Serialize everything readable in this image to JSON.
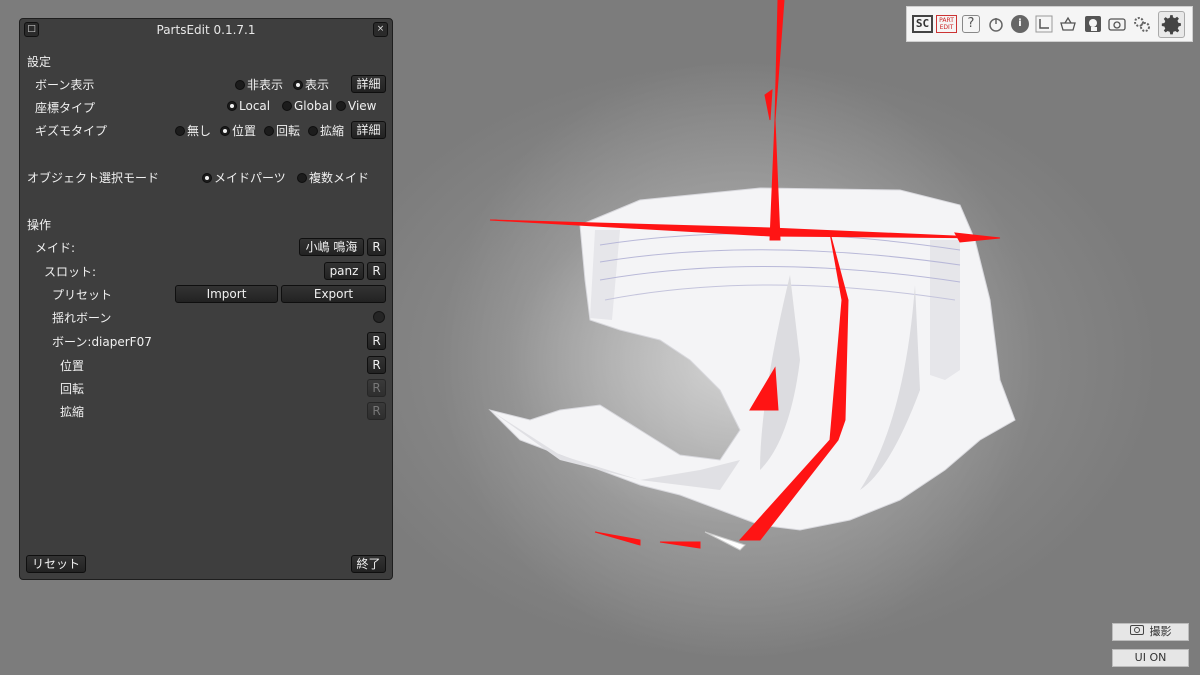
{
  "panel": {
    "title": "PartsEdit 0.1.7.1",
    "close_glyph": "×",
    "min_glyph": "□",
    "settings": {
      "heading": "設定",
      "bone_display": {
        "label": "ボーン表示",
        "options": [
          "非表示",
          "表示"
        ],
        "selected": "表示",
        "detail_button": "詳細"
      },
      "coord_type": {
        "label": "座標タイプ",
        "options": [
          "Local",
          "Global",
          "View"
        ],
        "selected": "Local"
      },
      "gizmo_type": {
        "label": "ギズモタイプ",
        "options": [
          "無し",
          "位置",
          "回転",
          "拡縮"
        ],
        "selected": "位置",
        "detail_button": "詳細"
      },
      "object_select": {
        "label": "オブジェクト選択モード",
        "options": [
          "メイドパーツ",
          "複数メイド"
        ],
        "selected": "メイドパーツ"
      }
    },
    "operations": {
      "heading": "操作",
      "maid": {
        "label": "メイド:",
        "value": "小嶋 鳴海",
        "reset": "R"
      },
      "slot": {
        "label": "スロット:",
        "value": "panz",
        "reset": "R"
      },
      "preset": {
        "label": "プリセット",
        "import": "Import",
        "export": "Export"
      },
      "sway_bone": {
        "label": "揺れボーン"
      },
      "bone": {
        "label": "ボーン:diaperF07",
        "reset": "R"
      },
      "position": {
        "label": "位置",
        "reset": "R"
      },
      "rotation": {
        "label": "回転",
        "reset": "R"
      },
      "scale": {
        "label": "拡縮",
        "reset": "R"
      }
    },
    "reset_button": "リセット",
    "exit_button": "終了"
  },
  "toolbar": {
    "sc": "SC",
    "part_edit": [
      "PART",
      "EDIT"
    ],
    "icons": [
      "sc-icon",
      "part-edit-icon",
      "help-icon",
      "power-icon",
      "info-icon",
      "axis-icon",
      "basket-icon",
      "camera-frame-icon",
      "camera-icon",
      "gear-small-icon",
      "gear-icon"
    ],
    "help": "?",
    "info": "i"
  },
  "bottom": {
    "shoot_button": "撮影",
    "ui_on_button": "UI ON"
  },
  "colors": {
    "panel_bg": "#3e3e3e",
    "gizmo_red": "#ff1414",
    "background": "#8a8a8a"
  }
}
